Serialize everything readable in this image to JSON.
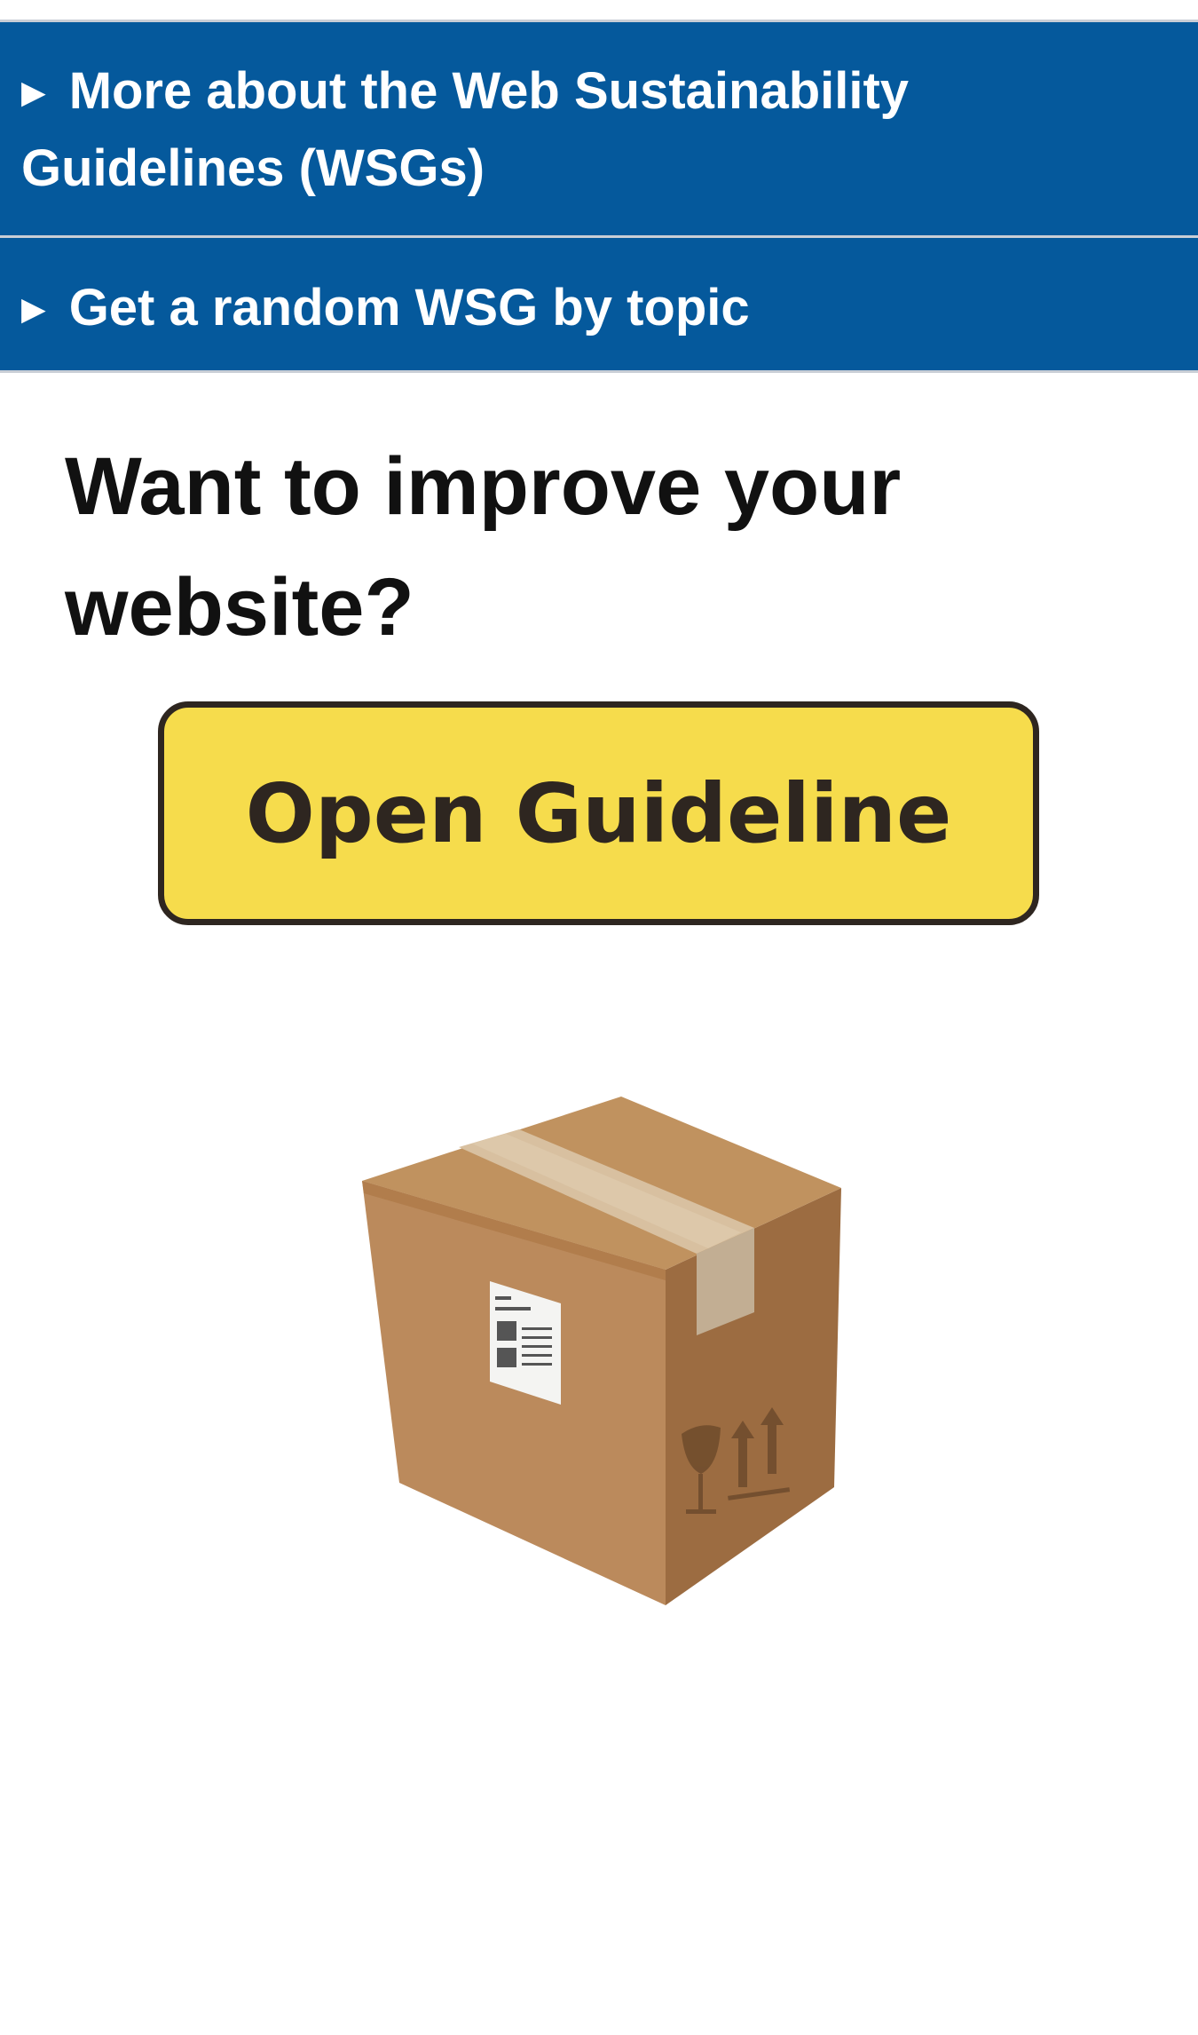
{
  "accordions": [
    {
      "marker": "▶",
      "label": "More about the Web Sustainability Guidelines (WSGs)"
    },
    {
      "marker": "▶",
      "label": "Get a random WSG by topic"
    }
  ],
  "heading": "Want to improve your website?",
  "cta": {
    "label": "Open Guideline"
  },
  "illustration": {
    "icon": "package-box-icon"
  },
  "colors": {
    "accordion_bg": "#05599c",
    "button_bg": "#f6dc4c",
    "button_text": "#2e2620",
    "heading_text": "#111111"
  }
}
